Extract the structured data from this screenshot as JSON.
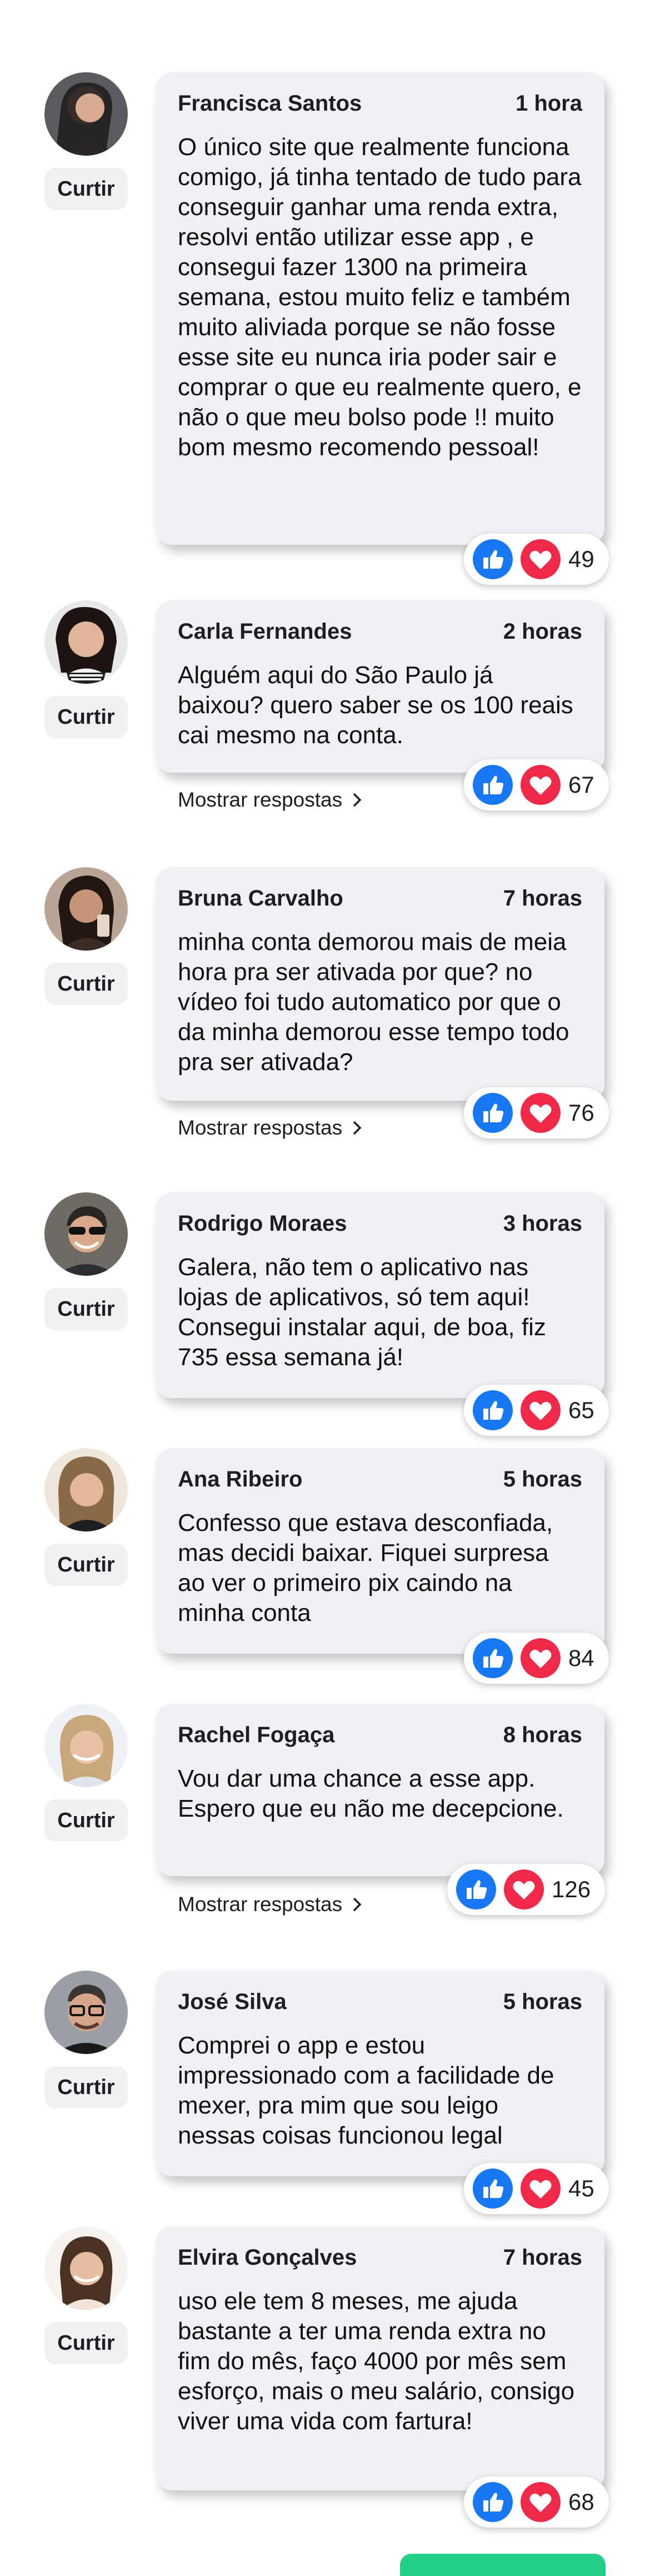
{
  "comments": [
    {
      "name": "Francisca Santos",
      "time": "1 hora",
      "text": "O único site que realmente funciona comigo, já tinha tentado de tudo para conseguir ganhar uma renda extra, resolvi então utilizar esse app , e consegui fazer 1300 na primeira semana, estou muito feliz e também muito aliviada porque se não fosse esse site eu nunca iria poder sair e comprar o que eu realmente quero, e não o que meu bolso pode !! muito bom mesmo recomendo pessoal!",
      "like_label": "Curtir",
      "reaction_count": "49"
    },
    {
      "name": "Carla Fernandes",
      "time": "2 horas",
      "text": "Alguém aqui do São Paulo já baixou? quero saber se os 100 reais cai mesmo na conta.",
      "like_label": "Curtir",
      "reaction_count": "67",
      "replies_label": "Mostrar respostas"
    },
    {
      "name": "Bruna Carvalho",
      "time": "7 horas",
      "text": "minha conta demorou mais de meia hora pra ser ativada por que? no vídeo foi tudo automatico por que o da minha demorou esse tempo todo pra ser ativada?",
      "like_label": "Curtir",
      "reaction_count": "76",
      "replies_label": "Mostrar respostas"
    },
    {
      "name": "Rodrigo Moraes",
      "time": "3 horas",
      "text": "Galera, não tem o aplicativo nas lojas de aplicativos, só tem aqui! Consegui instalar aqui, de boa, fiz 735 essa semana já!",
      "like_label": "Curtir",
      "reaction_count": "65"
    },
    {
      "name": "Ana Ribeiro",
      "time": "5 horas",
      "text": "Confesso que estava desconfiada, mas decidi baixar. Fiquei surpresa ao ver o primeiro pix caindo na minha conta",
      "like_label": "Curtir",
      "reaction_count": "84"
    },
    {
      "name": "Rachel Fogaça",
      "time": "8 horas",
      "text": "Vou dar uma chance a esse app. Espero que eu não me decepcione.",
      "like_label": "Curtir",
      "reaction_count": "126",
      "replies_label": "Mostrar respostas"
    },
    {
      "name": "José Silva",
      "time": "5 horas",
      "text": "Comprei o app e estou impressionado com a facilidade de mexer, pra mim que sou leigo nessas coisas funcionou legal",
      "like_label": "Curtir",
      "reaction_count": "45"
    },
    {
      "name": "Elvira Gonçalves",
      "time": "7 horas",
      "text": "uso ele tem 8 meses, me ajuda bastante a ter uma renda extra no fim do mês, faço 4000 por mês sem esforço, mais o meu salário, consigo viver uma vida com fartura!",
      "like_label": "Curtir",
      "reaction_count": "68"
    }
  ],
  "colors": {
    "like_blue": "#1877f2",
    "love_red": "#f02849",
    "bubble_bg": "#f0f1f5",
    "accent_green": "#22d08a"
  },
  "icons": {
    "like": "thumbs-up-icon",
    "love": "heart-icon",
    "replies": "chevron-right-icon"
  }
}
